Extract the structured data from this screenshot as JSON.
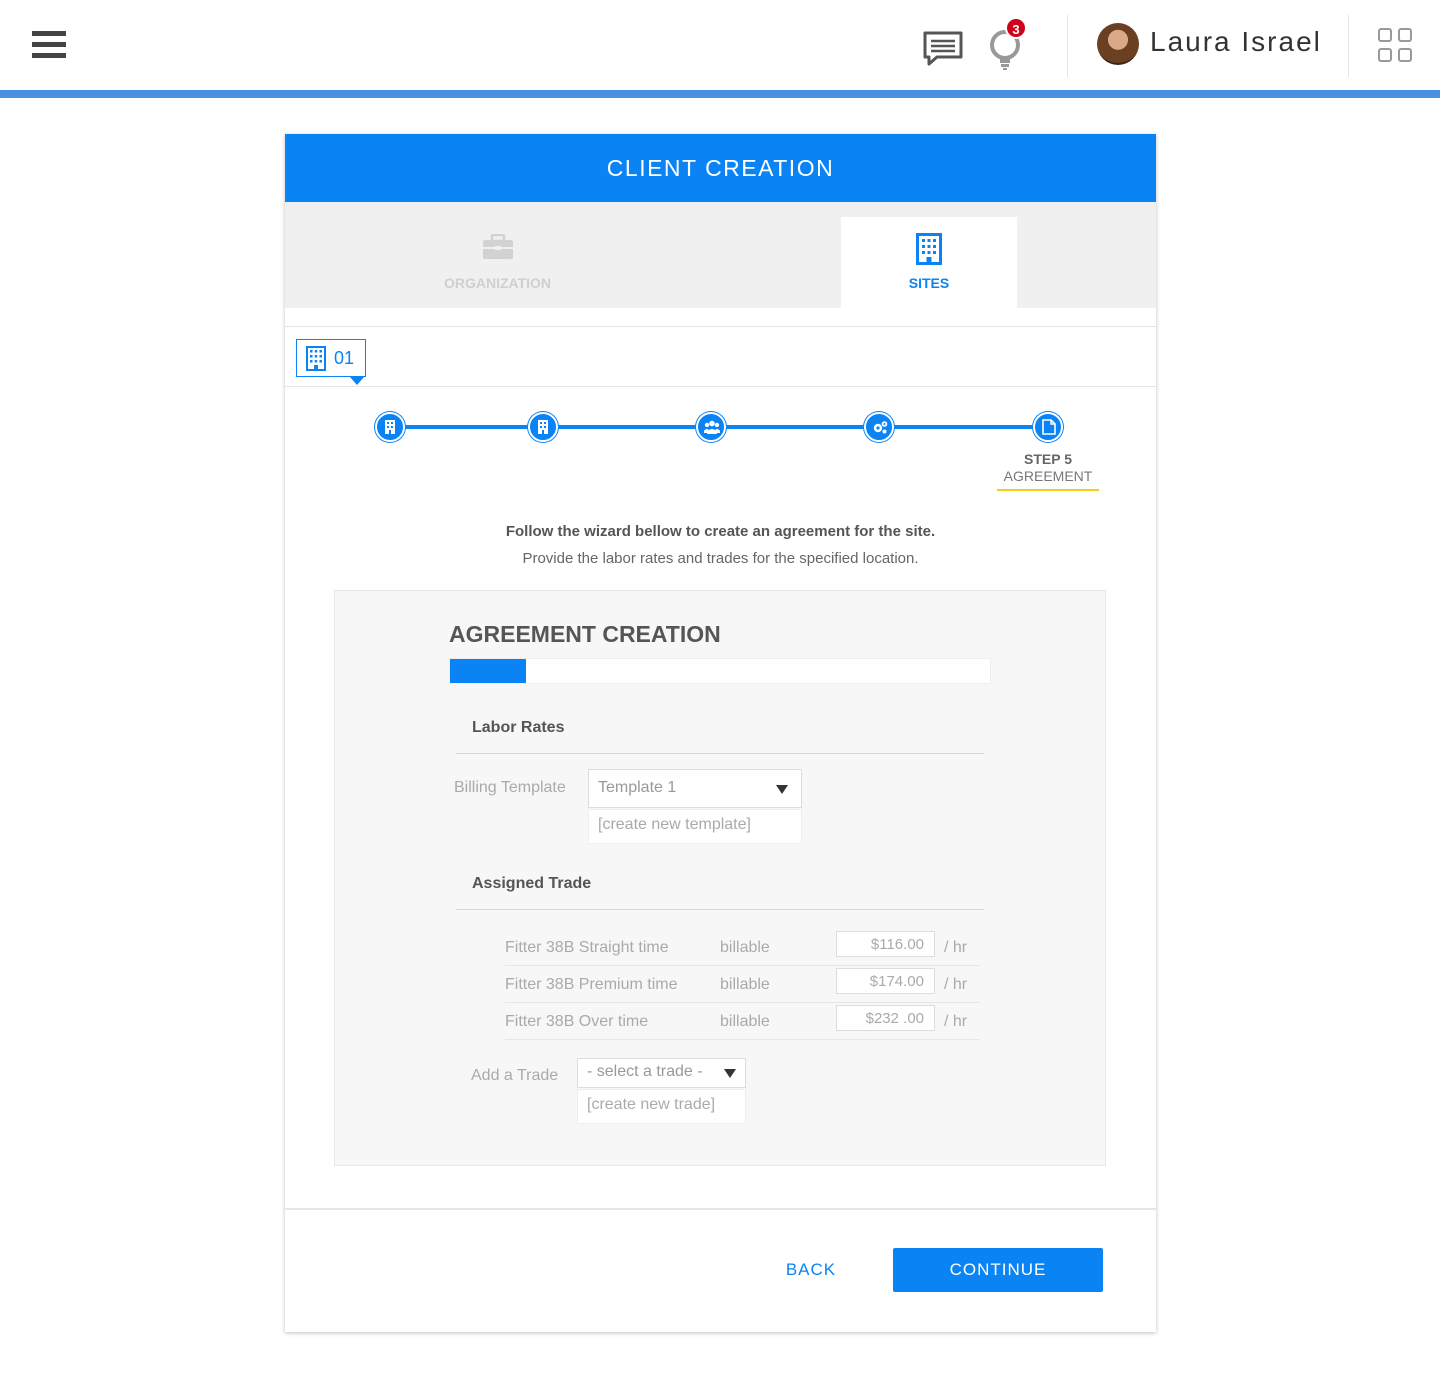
{
  "header": {
    "user_name": "Laura Israel",
    "notification_count": "3",
    "icons": [
      "hamburger-menu-icon",
      "chat-icon",
      "lightbulb-icon",
      "apps-grid-icon"
    ]
  },
  "card": {
    "title": "CLIENT CREATION",
    "tabs": [
      {
        "label": "ORGANIZATION",
        "icon": "briefcase-icon",
        "active": false
      },
      {
        "label": "SITES",
        "icon": "building-icon",
        "active": true
      }
    ],
    "site_chip": {
      "number": "01",
      "icon": "building-icon"
    }
  },
  "stepper": {
    "steps": [
      {
        "icon": "building-icon",
        "completed": true
      },
      {
        "icon": "building-icon",
        "completed": true
      },
      {
        "icon": "people-icon",
        "completed": true
      },
      {
        "icon": "gears-icon",
        "completed": true
      },
      {
        "icon": "document-icon",
        "active": true
      }
    ],
    "active_step_number": "STEP 5",
    "active_step_name": "AGREEMENT"
  },
  "intro": {
    "line1": "Follow the wizard bellow to create an agreement for the site.",
    "line2": "Provide the labor rates and trades for the specified location."
  },
  "agreement": {
    "title": "AGREEMENT CREATION",
    "progress_fraction": 0.14,
    "labor_rates": {
      "section_title": "Labor Rates",
      "billing_template_label": "Billing Template",
      "billing_template_value": "Template 1",
      "create_template_link": "[create new template]"
    },
    "assigned_trade": {
      "section_title": "Assigned Trade",
      "rows": [
        {
          "name": "Fitter 38B Straight time",
          "billing": "billable",
          "rate": "$116.00",
          "unit": "/ hr"
        },
        {
          "name": "Fitter 38B Premium time",
          "billing": "billable",
          "rate": "$174.00",
          "unit": "/ hr"
        },
        {
          "name": "Fitter 38B Over time",
          "billing": "billable",
          "rate": "$232 .00",
          "unit": "/ hr"
        }
      ],
      "add_trade_label": "Add a Trade",
      "add_trade_placeholder": "- select a trade -",
      "create_trade_link": "[create new trade]"
    }
  },
  "footer": {
    "back_label": "BACK",
    "continue_label": "CONTINUE"
  },
  "colors": {
    "primary": "#0a84f5",
    "topbar_accent": "#4a90e2",
    "badge": "#d0021b",
    "step_underline": "#f5d016"
  }
}
